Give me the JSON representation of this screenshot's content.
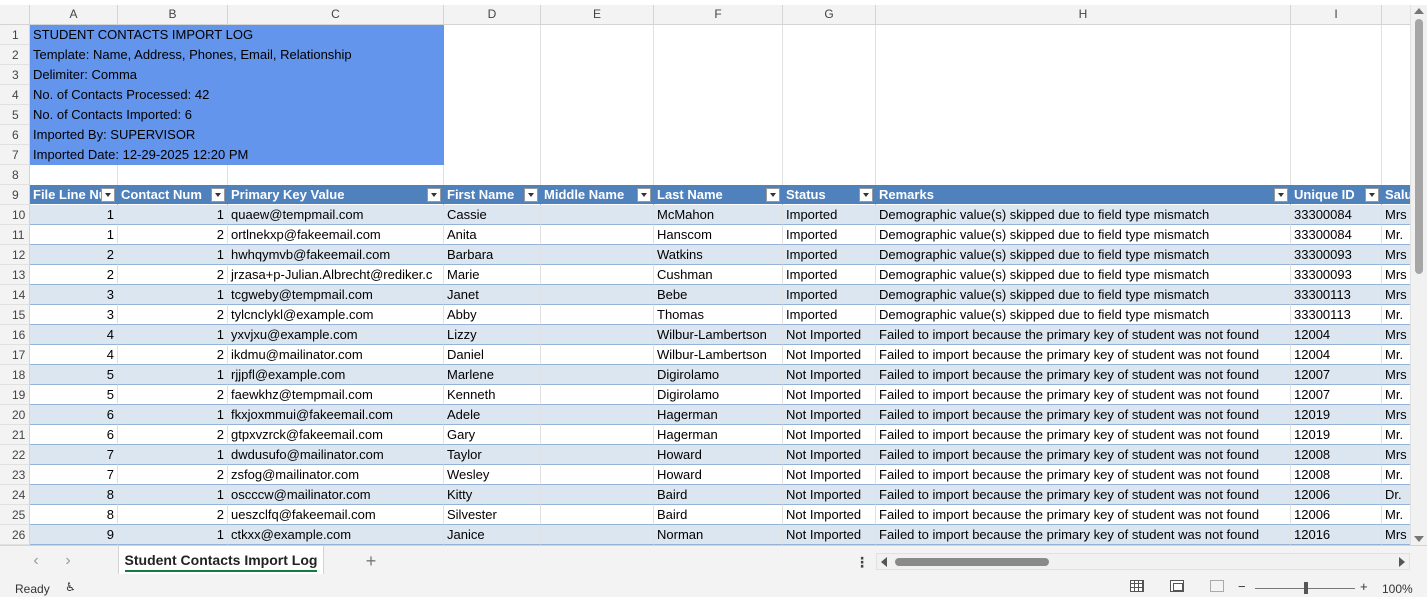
{
  "columns": [
    "A",
    "B",
    "C",
    "D",
    "E",
    "F",
    "G",
    "H",
    "I"
  ],
  "info_lines": [
    "STUDENT CONTACTS IMPORT LOG",
    "Template: Name, Address, Phones, Email, Relationship",
    "Delimiter: Comma",
    "No. of Contacts Processed: 42",
    "No. of Contacts Imported: 6",
    "Imported By: SUPERVISOR",
    "Imported Date: 12-29-2025 12:20 PM"
  ],
  "table": {
    "headers": [
      "File Line Nu",
      "Contact Num",
      "Primary Key Value",
      "First Name",
      "Middle Name",
      "Last Name",
      "Status",
      "Remarks",
      "Unique ID",
      "Salu"
    ],
    "rows": [
      [
        "1",
        "1",
        "quaew@tempmail.com",
        "Cassie",
        "",
        "McMahon",
        "Imported",
        "Demographic value(s) skipped due to field type mismatch",
        "33300084",
        "Mrs"
      ],
      [
        "1",
        "2",
        "ortlnekxp@fakeemail.com",
        "Anita",
        "",
        "Hanscom",
        "Imported",
        "Demographic value(s) skipped due to field type mismatch",
        "33300084",
        "Mr."
      ],
      [
        "2",
        "1",
        "hwhqymvb@fakeemail.com",
        "Barbara",
        "",
        "Watkins",
        "Imported",
        "Demographic value(s) skipped due to field type mismatch",
        "33300093",
        "Mrs"
      ],
      [
        "2",
        "2",
        "jrzasa+p-Julian.Albrecht@rediker.c",
        "Marie",
        "",
        "Cushman",
        "Imported",
        "Demographic value(s) skipped due to field type mismatch",
        "33300093",
        "Mrs"
      ],
      [
        "3",
        "1",
        "tcgweby@tempmail.com",
        "Janet",
        "",
        "Bebe",
        "Imported",
        "Demographic value(s) skipped due to field type mismatch",
        "33300113",
        "Mrs"
      ],
      [
        "3",
        "2",
        "tylcnclykl@example.com",
        "Abby",
        "",
        "Thomas",
        "Imported",
        "Demographic value(s) skipped due to field type mismatch",
        "33300113",
        "Mr."
      ],
      [
        "4",
        "1",
        "yxvjxu@example.com",
        "Lizzy",
        "",
        "Wilbur-Lambertson",
        "Not Imported",
        "Failed to import because the primary key of student was not found",
        "12004",
        "Mrs"
      ],
      [
        "4",
        "2",
        "ikdmu@mailinator.com",
        "Daniel",
        "",
        "Wilbur-Lambertson",
        "Not Imported",
        "Failed to import because the primary key of student was not found",
        "12004",
        "Mr."
      ],
      [
        "5",
        "1",
        "rjjpfl@example.com",
        "Marlene",
        "",
        "Digirolamo",
        "Not Imported",
        "Failed to import because the primary key of student was not found",
        "12007",
        "Mrs"
      ],
      [
        "5",
        "2",
        "faewkhz@tempmail.com",
        "Kenneth",
        "",
        "Digirolamo",
        "Not Imported",
        "Failed to import because the primary key of student was not found",
        "12007",
        "Mr."
      ],
      [
        "6",
        "1",
        "fkxjoxmmui@fakeemail.com",
        "Adele",
        "",
        "Hagerman",
        "Not Imported",
        "Failed to import because the primary key of student was not found",
        "12019",
        "Mrs"
      ],
      [
        "6",
        "2",
        "gtpxvzrck@fakeemail.com",
        "Gary",
        "",
        "Hagerman",
        "Not Imported",
        "Failed to import because the primary key of student was not found",
        "12019",
        "Mr."
      ],
      [
        "7",
        "1",
        "dwdusufo@mailinator.com",
        "Taylor",
        "",
        "Howard",
        "Not Imported",
        "Failed to import because the primary key of student was not found",
        "12008",
        "Mrs"
      ],
      [
        "7",
        "2",
        "zsfog@mailinator.com",
        "Wesley",
        "",
        "Howard",
        "Not Imported",
        "Failed to import because the primary key of student was not found",
        "12008",
        "Mr."
      ],
      [
        "8",
        "1",
        "oscccw@mailinator.com",
        "Kitty",
        "",
        "Baird",
        "Not Imported",
        "Failed to import because the primary key of student was not found",
        "12006",
        "Dr."
      ],
      [
        "8",
        "2",
        "ueszclfq@fakeemail.com",
        "Silvester",
        "",
        "Baird",
        "Not Imported",
        "Failed to import because the primary key of student was not found",
        "12006",
        "Mr."
      ],
      [
        "9",
        "1",
        "ctkxx@example.com",
        "Janice",
        "",
        "Norman",
        "Not Imported",
        "Failed to import because the primary key of student was not found",
        "12016",
        "Mrs"
      ]
    ]
  },
  "sheet_tab": "Student Contacts Import Log",
  "status": {
    "ready": "Ready",
    "zoom": "100%"
  },
  "colors": {
    "info_fill": "#6495ed",
    "header_fill": "#4f81bd",
    "band_fill": "#dce6f1"
  },
  "icons": {
    "prev_sheet": "chevron-left-icon",
    "next_sheet": "chevron-right-icon",
    "add_sheet": "plus-icon",
    "accessibility": "accessibility-icon"
  }
}
